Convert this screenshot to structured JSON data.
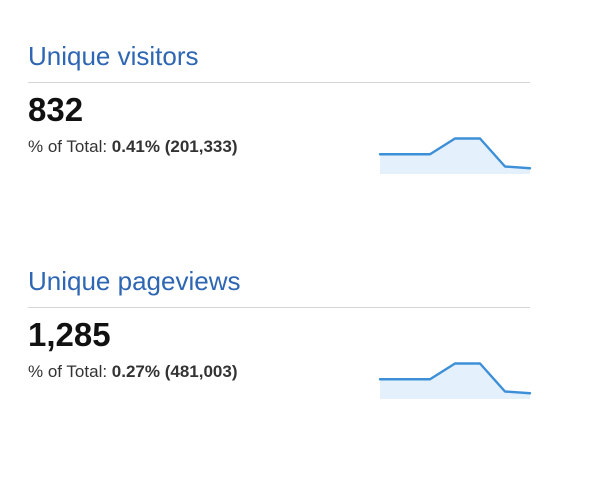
{
  "metrics": [
    {
      "title": "Unique visitors",
      "value": "832",
      "subline": {
        "prefix": "% of Total: ",
        "percent": "0.41%",
        "total": "(201,333)"
      },
      "sparkline": {
        "values": [
          0.45,
          0.45,
          0.45,
          0.9,
          0.9,
          0.1,
          0.05
        ]
      }
    },
    {
      "title": "Unique pageviews",
      "value": "1,285",
      "subline": {
        "prefix": "% of Total: ",
        "percent": "0.27%",
        "total": "(481,003)"
      },
      "sparkline": {
        "values": [
          0.45,
          0.45,
          0.45,
          0.9,
          0.9,
          0.1,
          0.05
        ]
      }
    }
  ],
  "colors": {
    "title": "#2f66b3",
    "divider": "#d5d5d5",
    "sparkline_line": "#3d8fd8",
    "sparkline_fill": "#e4f0fb"
  }
}
